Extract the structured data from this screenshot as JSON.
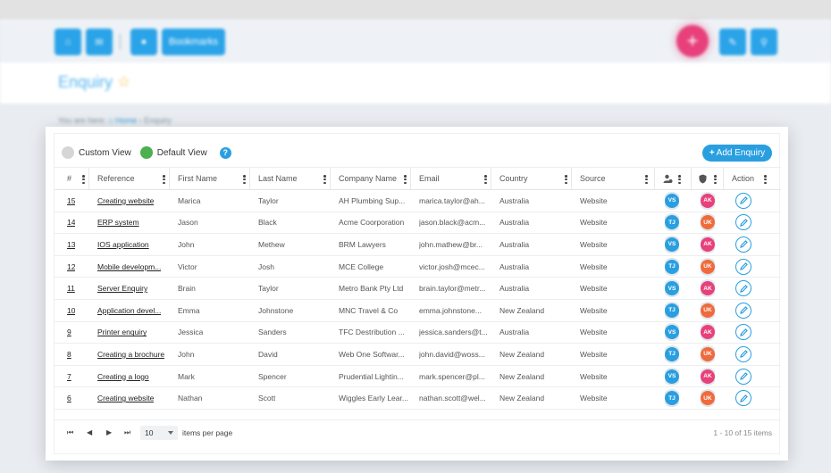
{
  "app": {
    "bookmarks_label": "Bookmarks",
    "page_title": "Enquiry",
    "breadcrumb": {
      "prefix": "You are here:",
      "home": "Home",
      "current": "Enquiry"
    }
  },
  "toolbar": {
    "custom_view_label": "Custom View",
    "default_view_label": "Default View",
    "help_label": "?",
    "add_button_label": "Add Enquiry"
  },
  "columns": [
    "#",
    "Reference",
    "First Name",
    "Last Name",
    "Company Name",
    "Email",
    "Country",
    "Source",
    "",
    "",
    "Action"
  ],
  "column_icons": {
    "owner": "user-gear-icon",
    "shield": "shield-icon",
    "edit": "pencil-icon"
  },
  "colors": {
    "primary": "#2a9fe0",
    "default_view": "#4caf50",
    "vs": "#2a9fe0",
    "tj": "#2a9fe0",
    "ak": "#e8407a",
    "uk": "#f06a3c"
  },
  "rows": [
    {
      "num": "15",
      "reference": "Creating website",
      "first": "Marica",
      "last": "Taylor",
      "company": "AH Plumbing Sup...",
      "email": "marica.taylor@ah...",
      "country": "Australia",
      "source": "Website",
      "owner": "VS",
      "assignee": "AK"
    },
    {
      "num": "14",
      "reference": "ERP system",
      "first": "Jason",
      "last": "Black",
      "company": "Acme Coorporation",
      "email": "jason.black@acm...",
      "country": "Australia",
      "source": "Website",
      "owner": "TJ",
      "assignee": "UK"
    },
    {
      "num": "13",
      "reference": "IOS application",
      "first": "John",
      "last": "Methew",
      "company": "BRM Lawyers",
      "email": "john.mathew@br...",
      "country": "Australia",
      "source": "Website",
      "owner": "VS",
      "assignee": "AK"
    },
    {
      "num": "12",
      "reference": "Mobile developm...",
      "first": "Victor",
      "last": "Josh",
      "company": "MCE College",
      "email": "victor.josh@mcec...",
      "country": "Australia",
      "source": "Website",
      "owner": "TJ",
      "assignee": "UK"
    },
    {
      "num": "11",
      "reference": "Server Enquiry",
      "first": "Brain",
      "last": "Taylor",
      "company": "Metro Bank Pty Ltd",
      "email": "brain.taylor@metr...",
      "country": "Australia",
      "source": "Website",
      "owner": "VS",
      "assignee": "AK"
    },
    {
      "num": "10",
      "reference": "Application devel...",
      "first": "Emma",
      "last": "Johnstone",
      "company": "MNC Travel & Co",
      "email": "emma.johnstone...",
      "country": "New Zealand",
      "source": "Website",
      "owner": "TJ",
      "assignee": "UK"
    },
    {
      "num": "9",
      "reference": "Printer enquiry",
      "first": "Jessica",
      "last": "Sanders",
      "company": "TFC Destribution ...",
      "email": "jessica.sanders@t...",
      "country": "Australia",
      "source": "Website",
      "owner": "VS",
      "assignee": "AK"
    },
    {
      "num": "8",
      "reference": "Creating a brochure",
      "first": "John",
      "last": "David",
      "company": "Web One Softwar...",
      "email": "john.david@woss...",
      "country": "New Zealand",
      "source": "Website",
      "owner": "TJ",
      "assignee": "UK"
    },
    {
      "num": "7",
      "reference": "Creating a logo",
      "first": "Mark",
      "last": "Spencer",
      "company": "Prudential Lightin...",
      "email": "mark.spencer@pl...",
      "country": "New Zealand",
      "source": "Website",
      "owner": "VS",
      "assignee": "AK"
    },
    {
      "num": "6",
      "reference": "Creating website",
      "first": "Nathan",
      "last": "Scott",
      "company": "Wiggles Early Lear...",
      "email": "nathan.scott@wel...",
      "country": "New Zealand",
      "source": "Website",
      "owner": "TJ",
      "assignee": "UK"
    }
  ],
  "pager": {
    "first_icon": "first-page-icon",
    "prev_icon": "prev-page-icon",
    "next_icon": "next-page-icon",
    "last_icon": "last-page-icon",
    "page_size": "10",
    "page_size_label": "items per page",
    "info": "1 - 10 of 15 items"
  }
}
